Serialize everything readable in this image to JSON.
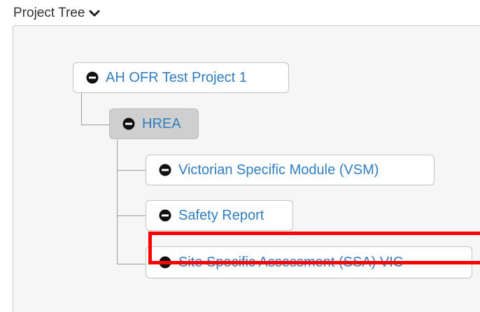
{
  "header": {
    "title": "Project Tree",
    "toggle_icon": "chevron-down-icon"
  },
  "tree": {
    "root": {
      "label": "AH OFR Test Project 1",
      "icon": "minus-circle-icon"
    },
    "child": {
      "label": "HREA",
      "icon": "minus-circle-icon",
      "selected": true
    },
    "leaves": [
      {
        "label": "Victorian Specific Module (VSM)",
        "icon": "minus-circle-icon"
      },
      {
        "label": "Safety Report",
        "icon": "minus-circle-icon"
      },
      {
        "label": "Site Specific Assessment (SSA) VIC -",
        "icon": "minus-circle-icon"
      }
    ]
  },
  "colors": {
    "link": "#2f7ec1",
    "highlight": "#ff0000",
    "selected_bg": "#cfcfcf",
    "panel_bg": "#f6f6f6"
  }
}
